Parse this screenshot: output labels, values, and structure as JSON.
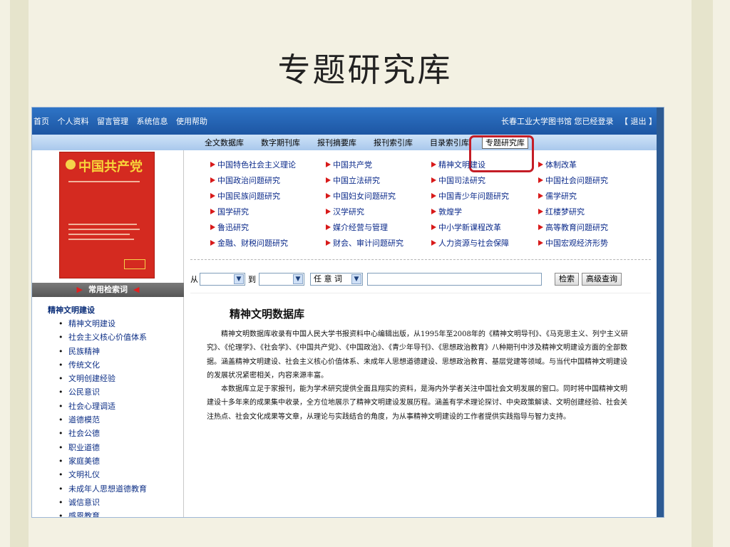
{
  "slide_title": "专题研究库",
  "topbar": {
    "nav": [
      "首页",
      "个人资料",
      "留言管理",
      "系统信息",
      "使用帮助"
    ],
    "login_text": "长春工业大学图书馆 您已经登录",
    "logout": "【 退出 】"
  },
  "tabs": [
    "全文数据库",
    "数字期刊库",
    "报刊摘要库",
    "报刊索引库",
    "目录索引库"
  ],
  "active_tab": "专题研究库",
  "cover": {
    "title": "中国共产党"
  },
  "left": {
    "header": "常用检索词",
    "group_title": "精神文明建设",
    "items": [
      "精神文明建设",
      "社会主义核心价值体系",
      "民族精神",
      "传统文化",
      "文明创建经验",
      "公民意识",
      "社会心理调适",
      "道德模范",
      "社会公德",
      "职业道德",
      "家庭美德",
      "文明礼仪",
      "未成年人思想道德教育",
      "诚信意识",
      "感恩教育"
    ]
  },
  "categories": [
    [
      "中国特色社会主义理论",
      "中国共产党",
      "精神文明建设",
      "体制改革"
    ],
    [
      "中国政治问题研究",
      "中国立法研究",
      "中国司法研究",
      "中国社会问题研究"
    ],
    [
      "中国民族问题研究",
      "中国妇女问题研究",
      "中国青少年问题研究",
      "儒学研究"
    ],
    [
      "国学研究",
      "汉学研究",
      "敦煌学",
      "红楼梦研究"
    ],
    [
      "鲁迅研究",
      "媒介经营与管理",
      "中小学新课程改革",
      "高等教育问题研究"
    ],
    [
      "金融、财税问题研究",
      "财会、审计问题研究",
      "人力资源与社会保障",
      "中国宏观经济形势"
    ]
  ],
  "search": {
    "from_label": "从",
    "to_label": "到",
    "field_value": "任 意 词",
    "search_button": "检索",
    "advanced_button": "高级查询"
  },
  "intro": {
    "title": "精神文明数据库",
    "p1": "精神文明数据库收录有中国人民大学书报资料中心编辑出版，从1995年至2008年的《精神文明导刊》、《马克思主义、列宁主义研究》、《伦理学》、《社会学》、《中国共产党》、《中国政治》、《青少年导刊》、《思想政治教育》八种期刊中涉及精神文明建设方面的全部数据。涵盖精神文明建设、社会主义核心价值体系、未成年人思想道德建设、思想政治教育、基层党建等领域。与当代中国精神文明建设的发展状况紧密相关，内容来源丰富。",
    "p2": "本数据库立足于家报刊，能为学术研究提供全面且翔实的资料，是海内外学者关注中国社会文明发展的窗口。同时将中国精神文明建设十多年来的成果集中收录，全方位地展示了精神文明建设发展历程。涵盖有学术理论探讨、中央政策解读、文明创建经验、社会关注热点、社会文化成果等文章，从理论与实践结合的角度，为从事精神文明建设的工作者提供实践指导与智力支持。"
  },
  "colors": {
    "accent_blue": "#1f5fad",
    "highlight_red": "#c41d26",
    "link_blue": "#0b2a8a"
  }
}
